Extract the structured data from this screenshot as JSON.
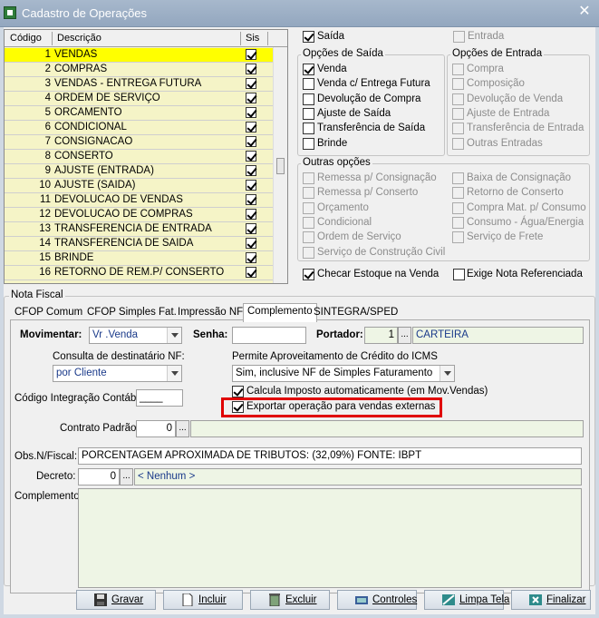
{
  "window": {
    "title": "Cadastro de Operações",
    "close_glyph": "✕"
  },
  "grid": {
    "headers": {
      "code": "Código",
      "description": "Descrição",
      "flag": "Sis"
    },
    "rows": [
      {
        "code": "1",
        "desc": "VENDAS",
        "checked": true
      },
      {
        "code": "2",
        "desc": "COMPRAS",
        "checked": true
      },
      {
        "code": "3",
        "desc": "VENDAS - ENTREGA FUTURA",
        "checked": true
      },
      {
        "code": "4",
        "desc": "ORDEM DE SERVIÇO",
        "checked": true
      },
      {
        "code": "5",
        "desc": "ORCAMENTO",
        "checked": true
      },
      {
        "code": "6",
        "desc": "CONDICIONAL",
        "checked": true
      },
      {
        "code": "7",
        "desc": "CONSIGNACAO",
        "checked": true
      },
      {
        "code": "8",
        "desc": "CONSERTO",
        "checked": true
      },
      {
        "code": "9",
        "desc": "AJUSTE (ENTRADA)",
        "checked": true
      },
      {
        "code": "10",
        "desc": "AJUSTE (SAIDA)",
        "checked": true
      },
      {
        "code": "11",
        "desc": "DEVOLUCAO DE VENDAS",
        "checked": true
      },
      {
        "code": "12",
        "desc": "DEVOLUCAO DE COMPRAS",
        "checked": true
      },
      {
        "code": "13",
        "desc": "TRANSFERENCIA DE ENTRADA",
        "checked": true
      },
      {
        "code": "14",
        "desc": "TRANSFERENCIA DE SAIDA",
        "checked": true
      },
      {
        "code": "15",
        "desc": "BRINDE",
        "checked": true
      },
      {
        "code": "16",
        "desc": "RETORNO DE REM.P/ CONSERTO",
        "checked": true
      }
    ]
  },
  "top_checks": {
    "saida": "Saída",
    "entrada": "Entrada"
  },
  "opcoes_saida": {
    "title": "Opções de Saída",
    "items": [
      "Venda",
      "Venda c/ Entrega Futura",
      "Devolução de Compra",
      "Ajuste de Saída",
      "Transferência de Saída",
      "Brinde"
    ]
  },
  "opcoes_entrada": {
    "title": "Opções de Entrada",
    "items": [
      "Compra",
      "Composição",
      "Devolução de Venda",
      "Ajuste de Entrada",
      "Transferência de Entrada",
      "Outras Entradas"
    ]
  },
  "outras_opcoes": {
    "title": "Outras opções",
    "left": [
      "Remessa p/ Consignação",
      "Remessa p/ Conserto",
      "Orçamento",
      "Condicional",
      "Ordem de Serviço",
      "Serviço de Construção Civil"
    ],
    "right": [
      "Baixa de Consignação",
      "Retorno de Conserto",
      "Compra Mat. p/ Consumo",
      "Consumo - Água/Energia",
      "Serviço de Frete"
    ]
  },
  "estoque": {
    "checar": "Checar Estoque na Venda",
    "exige": "Exige Nota Referenciada"
  },
  "nota_fiscal": {
    "group_title": "Nota Fiscal",
    "tabs": [
      "CFOP Comum",
      "CFOP Simples Fat.",
      "Impressão NF",
      "Complemento",
      "SINTEGRA/SPED"
    ]
  },
  "complemento": {
    "movimentar_label": "Movimentar:",
    "movimentar_value": "Vr .Venda",
    "senha_label": "Senha:",
    "senha_value": "",
    "portador_label": "Portador:",
    "portador_code": "1",
    "portador_name": "CARTEIRA",
    "consulta_label": "Consulta de destinatário NF:",
    "consulta_value": "por Cliente",
    "credito_label": "Permite Aproveitamento de Crédito do ICMS",
    "credito_value": "Sim, inclusive NF de Simples Faturamento",
    "calcula_label": "Calcula Imposto automaticamente (em Mov.Vendas)",
    "exportar_label": "Exportar operação para vendas externas",
    "integracao_label": "Código Integração Contábil:",
    "integracao_value": "____",
    "contrato_label": "Contrato Padrão:",
    "contrato_value": "0",
    "obs_label": "Obs.N/Fiscal:",
    "obs_value": "PORCENTAGEM APROXIMADA DE TRIBUTOS: (32,09%) FONTE: IBPT",
    "decreto_label": "Decreto:",
    "decreto_value": "0",
    "decreto_name": "< Nenhum >",
    "complemento_label": "Complemento:",
    "complemento_value": "",
    "dots": "..."
  },
  "buttons": {
    "gravar": "Gravar",
    "incluir": "Incluir",
    "excluir": "Excluir",
    "controles": "Controles",
    "limpa": "Limpa Tela",
    "finalizar": "Finalizar"
  }
}
